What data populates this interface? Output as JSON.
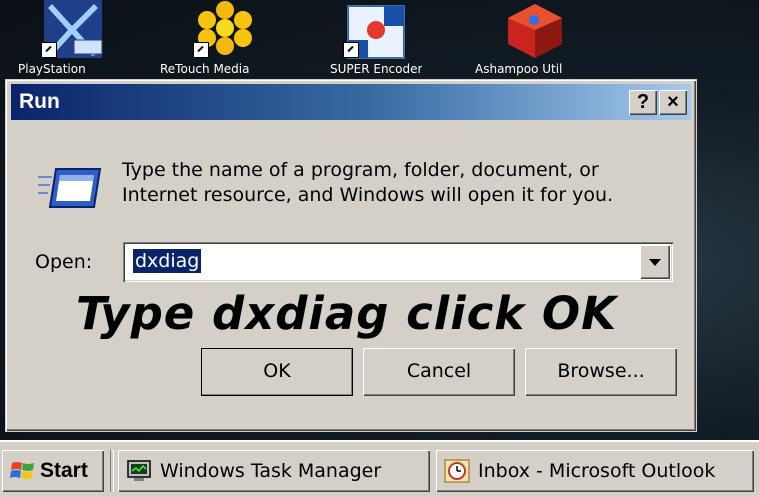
{
  "desktop": {
    "icons": [
      {
        "name": "playstation-icon",
        "label": "PlayStation"
      },
      {
        "name": "flower-app-icon",
        "label": "ReTouch Media"
      },
      {
        "name": "media-app-icon",
        "label": "SUPER Encoder"
      },
      {
        "name": "cube-app-icon",
        "label": "Ashampoo Util"
      }
    ]
  },
  "dialog": {
    "title": "Run",
    "help_label": "?",
    "close_label": "×",
    "prompt": "Type the name of a program, folder, document, or Internet resource, and Windows will open it for you.",
    "open_label": "Open:",
    "open_value": "dxdiag",
    "annotation": "Type dxdiag click OK",
    "buttons": {
      "ok": "OK",
      "cancel": "Cancel",
      "browse": "Browse..."
    }
  },
  "taskbar": {
    "start_label": "Start",
    "tasks": [
      {
        "label": "Windows Task Manager",
        "icon": "task-manager-icon"
      },
      {
        "label": "Inbox - Microsoft Outlook",
        "icon": "outlook-icon"
      }
    ]
  },
  "colors": {
    "titlebar_start": "#0a246a",
    "titlebar_end": "#a6caf0",
    "face": "#d4d0c8"
  }
}
